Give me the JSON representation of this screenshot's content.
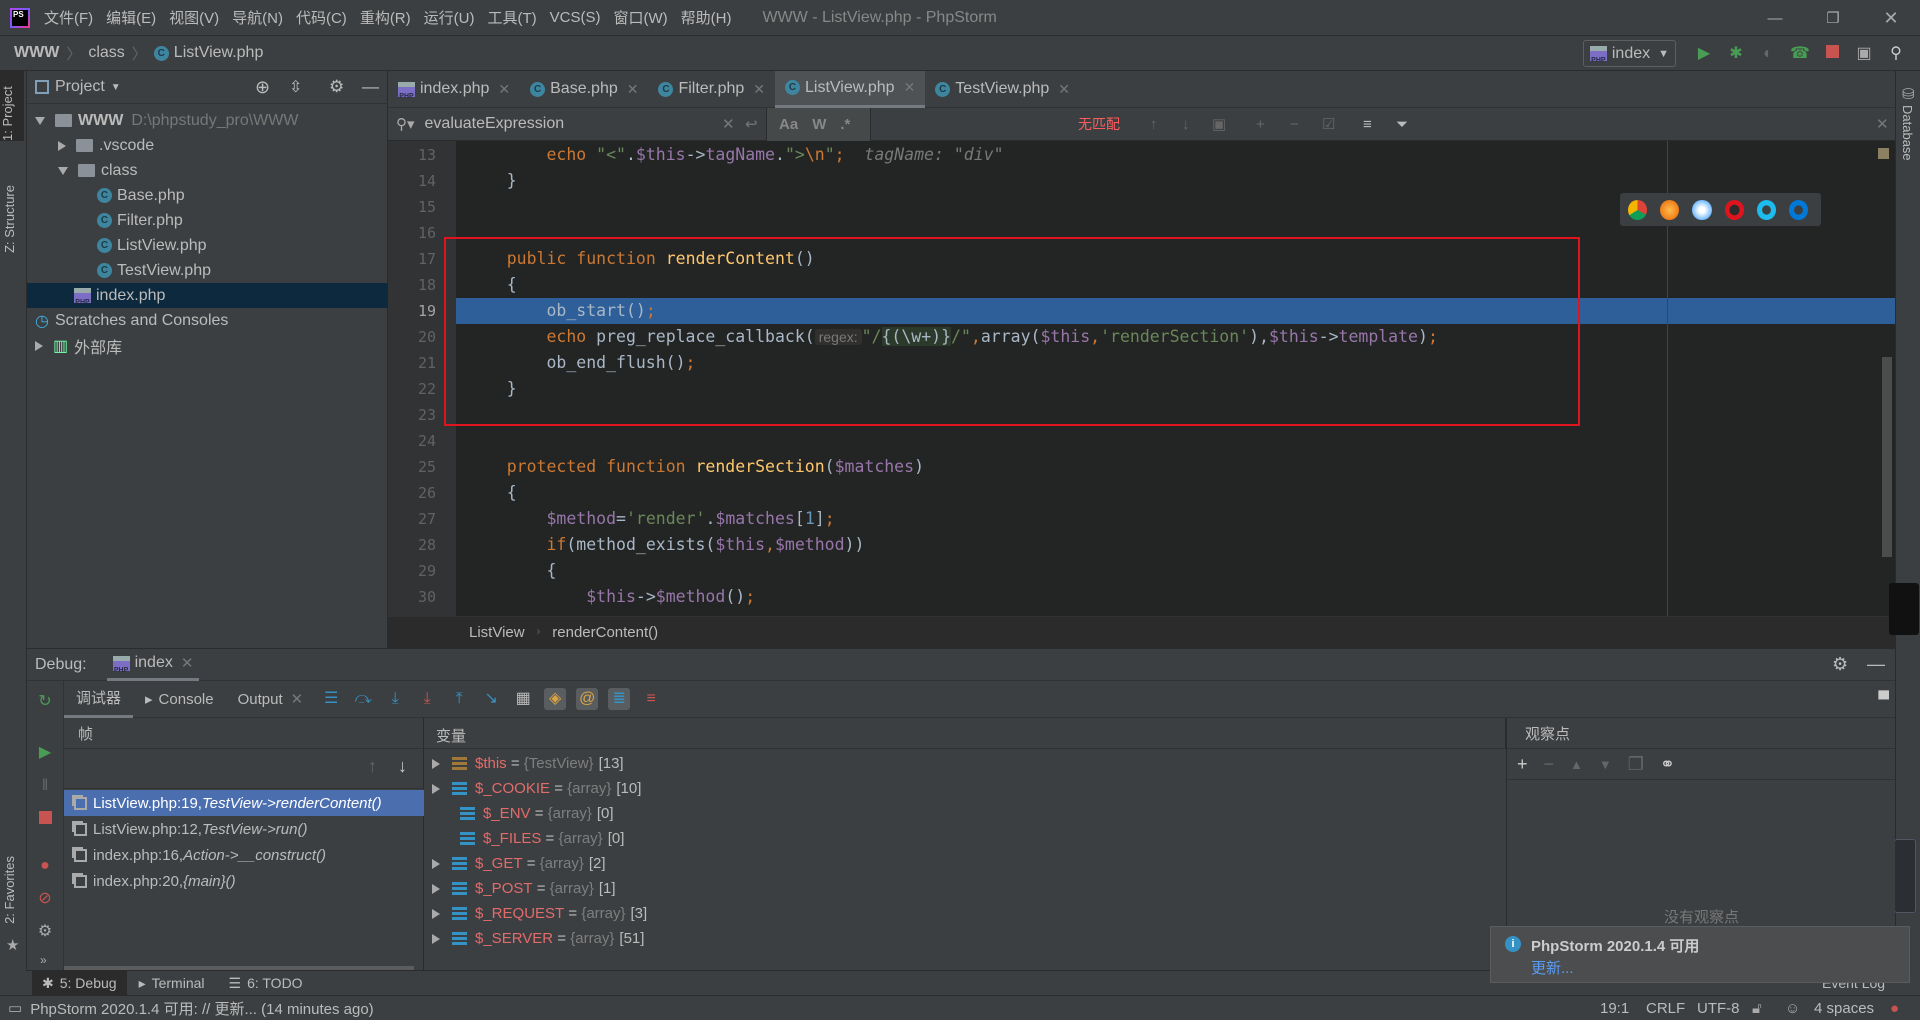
{
  "titlebar": {
    "menus": [
      "文件(F)",
      "编辑(E)",
      "视图(V)",
      "导航(N)",
      "代码(C)",
      "重构(R)",
      "运行(U)",
      "工具(T)",
      "VCS(S)",
      "窗口(W)",
      "帮助(H)"
    ],
    "title": "WWW - ListView.php - PhpStorm",
    "logo": "PS"
  },
  "navbar": {
    "crumbs": [
      "WWW",
      "class",
      "ListView.php"
    ],
    "run_config": "index"
  },
  "left_stripe": {
    "project_tab": "1: Project",
    "structure_tab": "Z: Structure",
    "favorites_tab": "2: Favorites"
  },
  "right_stripe": {
    "database_tab": "Database"
  },
  "project": {
    "title": "Project",
    "tree": [
      {
        "label": "WWW",
        "path": "D:\\phpstudy_pro\\WWW",
        "type": "folder",
        "expanded": true,
        "depth": 0
      },
      {
        "label": ".vscode",
        "type": "folder",
        "expanded": false,
        "depth": 1
      },
      {
        "label": "class",
        "type": "folder",
        "expanded": true,
        "depth": 1
      },
      {
        "label": "Base.php",
        "type": "class",
        "depth": 2
      },
      {
        "label": "Filter.php",
        "type": "class",
        "depth": 2
      },
      {
        "label": "ListView.php",
        "type": "class",
        "depth": 2
      },
      {
        "label": "TestView.php",
        "type": "class",
        "depth": 2
      },
      {
        "label": "index.php",
        "type": "php",
        "depth": 1,
        "selected": true
      },
      {
        "label": "Scratches and Consoles",
        "type": "scratch",
        "depth": 0
      },
      {
        "label": "外部库",
        "type": "lib",
        "expanded": false,
        "depth": 0
      }
    ]
  },
  "tabs": [
    {
      "label": "index.php",
      "type": "php"
    },
    {
      "label": "Base.php",
      "type": "class"
    },
    {
      "label": "Filter.php",
      "type": "class"
    },
    {
      "label": "ListView.php",
      "type": "class",
      "active": true
    },
    {
      "label": "TestView.php",
      "type": "class"
    }
  ],
  "search": {
    "value": "evaluateExpression",
    "match_case": "Aa",
    "words": "W",
    "regex": ".*",
    "result": "无匹配"
  },
  "code": {
    "current_line": 19,
    "lines": [
      {
        "n": 13,
        "t": [
          [
            "        ",
            ""
          ],
          [
            "echo ",
            "kw"
          ],
          [
            "\"<\"",
            "str"
          ],
          [
            ".",
            ""
          ],
          [
            "$this",
            "var"
          ],
          [
            "->",
            ""
          ],
          [
            "tagName",
            "var"
          ],
          [
            ".",
            ""
          ],
          [
            "\">",
            "str"
          ],
          [
            "\\n",
            "kw"
          ],
          [
            "\"",
            "str"
          ],
          [
            ";",
            "kw"
          ],
          [
            "  tagName: \"div\"",
            "hint"
          ]
        ]
      },
      {
        "n": 14,
        "t": [
          [
            "    }",
            ""
          ]
        ]
      },
      {
        "n": 15,
        "t": []
      },
      {
        "n": 16,
        "t": []
      },
      {
        "n": 17,
        "t": [
          [
            "    ",
            ""
          ],
          [
            "public function ",
            "kw"
          ],
          [
            "renderContent",
            "fn"
          ],
          [
            "()",
            ""
          ]
        ]
      },
      {
        "n": 18,
        "t": [
          [
            "    {",
            ""
          ]
        ]
      },
      {
        "n": 19,
        "t": [
          [
            "        ob_start()",
            ""
          ],
          [
            ";",
            "kw"
          ]
        ]
      },
      {
        "n": 20,
        "t": [
          [
            "        ",
            ""
          ],
          [
            "echo ",
            "kw"
          ],
          [
            "preg_replace_callback(",
            ""
          ],
          [
            "regex:",
            "pill"
          ],
          [
            "\"/",
            "str"
          ],
          [
            "{(\\w+)}",
            "rx"
          ],
          [
            "/\"",
            "str"
          ],
          [
            ",",
            "kw"
          ],
          [
            "array(",
            ""
          ],
          [
            "$this",
            "var"
          ],
          [
            ",",
            "kw"
          ],
          [
            "'renderSection'",
            "str"
          ],
          [
            "),",
            ""
          ],
          [
            "$this",
            "var"
          ],
          [
            "->",
            ""
          ],
          [
            "template",
            "var"
          ],
          [
            ")",
            ""
          ],
          [
            ";",
            "kw"
          ]
        ]
      },
      {
        "n": 21,
        "t": [
          [
            "        ob_end_flush()",
            ""
          ],
          [
            ";",
            "kw"
          ]
        ]
      },
      {
        "n": 22,
        "t": [
          [
            "    }",
            ""
          ]
        ]
      },
      {
        "n": 23,
        "t": []
      },
      {
        "n": 24,
        "t": []
      },
      {
        "n": 25,
        "t": [
          [
            "    ",
            ""
          ],
          [
            "protected function ",
            "kw"
          ],
          [
            "renderSection",
            "fn"
          ],
          [
            "(",
            ""
          ],
          [
            "$matches",
            "var"
          ],
          [
            ")",
            ""
          ]
        ]
      },
      {
        "n": 26,
        "t": [
          [
            "    {",
            ""
          ]
        ]
      },
      {
        "n": 27,
        "t": [
          [
            "        ",
            ""
          ],
          [
            "$method",
            "var"
          ],
          [
            "=",
            ""
          ],
          [
            "'render'",
            "str"
          ],
          [
            ".",
            ""
          ],
          [
            "$matches",
            "var"
          ],
          [
            "[",
            ""
          ],
          [
            "1",
            "num"
          ],
          [
            "]",
            ""
          ],
          [
            ";",
            "kw"
          ]
        ]
      },
      {
        "n": 28,
        "t": [
          [
            "        ",
            ""
          ],
          [
            "if",
            "kw"
          ],
          [
            "(method_exists(",
            ""
          ],
          [
            "$this",
            "var"
          ],
          [
            ",",
            "kw"
          ],
          [
            "$method",
            "var"
          ],
          [
            "))",
            ""
          ]
        ]
      },
      {
        "n": 29,
        "t": [
          [
            "        {",
            ""
          ]
        ]
      },
      {
        "n": 30,
        "t": [
          [
            "            ",
            ""
          ],
          [
            "$this",
            "var"
          ],
          [
            "->",
            ""
          ],
          [
            "$method",
            "var"
          ],
          [
            "()",
            ""
          ],
          [
            ";",
            "kw"
          ]
        ]
      }
    ]
  },
  "editor_breadcrumb": [
    "ListView",
    "renderContent()"
  ],
  "browsers": [
    "chrome-icon",
    "firefox-icon",
    "safari-icon",
    "opera-icon",
    "ie-icon",
    "edge-icon"
  ],
  "debug": {
    "label": "Debug:",
    "session": "index",
    "tabs": [
      "调试器",
      "Console",
      "Output"
    ],
    "frames_header": "帧",
    "variables_header": "变量",
    "watches_header": "观察点",
    "no_watches": "没有观察点",
    "frames": [
      {
        "loc": "ListView.php:19, ",
        "fn": "TestView->renderContent()",
        "selected": true
      },
      {
        "loc": "ListView.php:12, ",
        "fn": "TestView->run()"
      },
      {
        "loc": "index.php:16, ",
        "fn": "Action->__construct()"
      },
      {
        "loc": "index.php:20, ",
        "fn": "{main}()"
      }
    ],
    "variables": [
      {
        "name": "$this",
        "type": "{TestView}",
        "count": "[13]",
        "expandable": true,
        "kind": "object"
      },
      {
        "name": "$_COOKIE",
        "type": "{array}",
        "count": "[10]",
        "expandable": true
      },
      {
        "name": "$_ENV",
        "type": "{array}",
        "count": "[0]",
        "expandable": false
      },
      {
        "name": "$_FILES",
        "type": "{array}",
        "count": "[0]",
        "expandable": false
      },
      {
        "name": "$_GET",
        "type": "{array}",
        "count": "[2]",
        "expandable": true
      },
      {
        "name": "$_POST",
        "type": "{array}",
        "count": "[1]",
        "expandable": true
      },
      {
        "name": "$_REQUEST",
        "type": "{array}",
        "count": "[3]",
        "expandable": true
      },
      {
        "name": "$_SERVER",
        "type": "{array}",
        "count": "[51]",
        "expandable": true
      }
    ]
  },
  "bottom_tabs": [
    "5: Debug",
    "Terminal",
    "6: TODO"
  ],
  "event_log": "Event Log",
  "notification": {
    "title": "PhpStorm 2020.1.4 可用",
    "link": "更新..."
  },
  "status": {
    "message": "PhpStorm 2020.1.4 可用: // 更新... (14 minutes ago)",
    "position": "19:1",
    "line_sep": "CRLF",
    "encoding": "UTF-8",
    "indent": "4 spaces"
  },
  "colors": {
    "keyword": "#cc7832",
    "function": "#ffc66d",
    "variable": "#9876aa",
    "string": "#6a8759",
    "current_line": "#2f5f99",
    "annotation_box": "#e0141e"
  }
}
